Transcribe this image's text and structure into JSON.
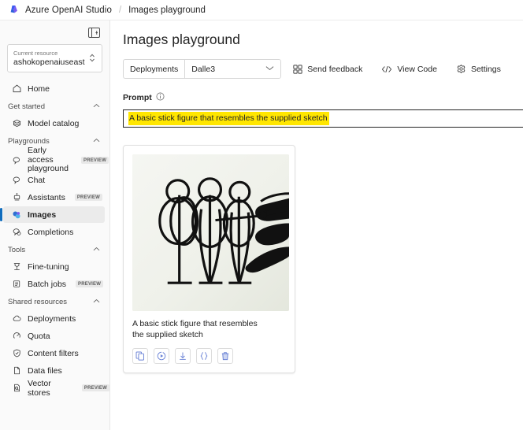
{
  "topbar": {
    "logo_icon": "azure-logo-icon",
    "brand": "Azure OpenAI Studio",
    "separator": "/",
    "breadcrumb_current": "Images playground"
  },
  "sidebar": {
    "collapse_icon": "panel-collapse-icon",
    "resource": {
      "label": "Current resource",
      "value": "ashokopenaiuseast",
      "chevron_icon": "chevron-up-down-icon"
    },
    "items": [
      {
        "label": "Home",
        "icon": "home-icon",
        "badge": "",
        "selected": false
      }
    ],
    "groups": [
      {
        "title": "Get started",
        "chevron_icon": "chevron-up-icon",
        "items": [
          {
            "label": "Model catalog",
            "icon": "model-catalog-icon",
            "badge": "",
            "selected": false
          }
        ]
      },
      {
        "title": "Playgrounds",
        "chevron_icon": "chevron-up-icon",
        "items": [
          {
            "label": "Early access playground",
            "icon": "chat-bubble-icon",
            "badge": "PREVIEW",
            "selected": false
          },
          {
            "label": "Chat",
            "icon": "chat-bubble-icon",
            "badge": "",
            "selected": false
          },
          {
            "label": "Assistants",
            "icon": "assistant-robot-icon",
            "badge": "PREVIEW",
            "selected": false
          },
          {
            "label": "Images",
            "icon": "images-icon",
            "badge": "",
            "selected": true
          },
          {
            "label": "Completions",
            "icon": "completions-icon",
            "badge": "",
            "selected": false
          }
        ]
      },
      {
        "title": "Tools",
        "chevron_icon": "chevron-up-icon",
        "items": [
          {
            "label": "Fine-tuning",
            "icon": "fine-tuning-icon",
            "badge": "",
            "selected": false
          },
          {
            "label": "Batch jobs",
            "icon": "batch-jobs-icon",
            "badge": "PREVIEW",
            "selected": false
          }
        ]
      },
      {
        "title": "Shared resources",
        "chevron_icon": "chevron-up-icon",
        "items": [
          {
            "label": "Deployments",
            "icon": "deployments-cloud-icon",
            "badge": "",
            "selected": false
          },
          {
            "label": "Quota",
            "icon": "quota-gauge-icon",
            "badge": "",
            "selected": false
          },
          {
            "label": "Content filters",
            "icon": "shield-icon",
            "badge": "",
            "selected": false
          },
          {
            "label": "Data files",
            "icon": "document-icon",
            "badge": "",
            "selected": false
          },
          {
            "label": "Vector stores",
            "icon": "vector-store-icon",
            "badge": "PREVIEW",
            "selected": false
          }
        ]
      }
    ]
  },
  "main": {
    "page_title": "Images playground",
    "toolbar": {
      "deployments_label": "Deployments",
      "deployment_value": "Dalle3",
      "deployment_chevron_icon": "chevron-down-icon",
      "send_feedback": "Send feedback",
      "send_feedback_icon": "grid-squares-icon",
      "view_code": "View Code",
      "view_code_icon": "code-brackets-icon",
      "settings": "Settings",
      "settings_icon": "gear-icon"
    },
    "prompt": {
      "label": "Prompt",
      "info_icon": "info-circle-icon",
      "value": "A basic stick figure that resembles the supplied sketch",
      "highlight_color": "#ffe600"
    },
    "result_card": {
      "image_alt": "three stick figures being drawn by a hand",
      "caption": "A basic stick figure that resembles the supplied sketch",
      "actions": [
        {
          "name": "copy-icon",
          "title": "Copy"
        },
        {
          "name": "regenerate-icon",
          "title": "Regenerate"
        },
        {
          "name": "download-icon",
          "title": "Download"
        },
        {
          "name": "json-braces-icon",
          "title": "View JSON"
        },
        {
          "name": "delete-icon",
          "title": "Delete"
        }
      ]
    }
  },
  "colors": {
    "accent": "#0f6cbd",
    "icon_blue": "#6b83d6",
    "highlight": "#ffe600",
    "sidebar_bg": "#fafafa",
    "selected_bg": "#ebebeb"
  }
}
